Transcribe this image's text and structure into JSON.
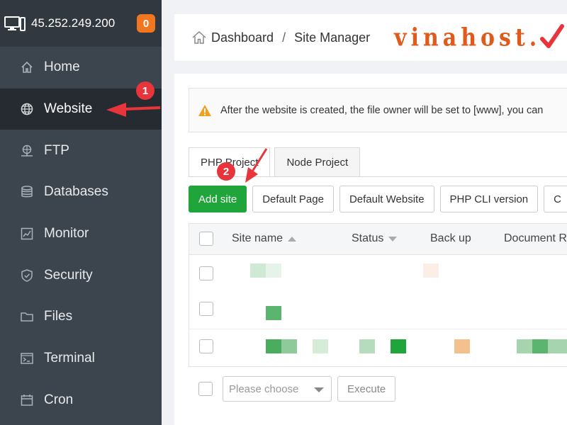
{
  "sidebar": {
    "server_ip": "45.252.249.200",
    "notification_count": "0",
    "items": [
      {
        "label": "Home",
        "icon": "home-icon"
      },
      {
        "label": "Website",
        "icon": "globe-icon"
      },
      {
        "label": "FTP",
        "icon": "ftp-icon"
      },
      {
        "label": "Databases",
        "icon": "database-icon"
      },
      {
        "label": "Monitor",
        "icon": "monitor-chart-icon"
      },
      {
        "label": "Security",
        "icon": "shield-icon"
      },
      {
        "label": "Files",
        "icon": "folder-icon"
      },
      {
        "label": "Terminal",
        "icon": "terminal-icon"
      },
      {
        "label": "Cron",
        "icon": "calendar-icon"
      }
    ],
    "active_item": "Website"
  },
  "header": {
    "breadcrumb_home": "Dashboard",
    "separator": "/",
    "breadcrumb_current": "Site Manager",
    "logo_text": "vinahost."
  },
  "alert": {
    "text": "After the website is created, the file owner will be set to [www], you can"
  },
  "tabs": [
    {
      "label": "PHP Project"
    },
    {
      "label": "Node Project"
    }
  ],
  "toolbar": {
    "add_site": "Add site",
    "default_page": "Default Page",
    "default_website": "Default Website",
    "php_cli_version": "PHP CLI version",
    "more": "C"
  },
  "table": {
    "columns": {
      "site_name": "Site name",
      "status": "Status",
      "backup": "Back up",
      "document_root": "Document R"
    }
  },
  "footer": {
    "select_placeholder": "Please choose",
    "execute": "Execute"
  },
  "annotations": {
    "step1": "1",
    "step2": "2"
  },
  "colors": {
    "sidebar_bg": "#3c444d",
    "sidebar_active": "#262b31",
    "accent_green": "#20a53a",
    "badge_orange": "#f0761f",
    "annotation_red": "#e8353c",
    "logo_orange": "#e05a1c"
  }
}
